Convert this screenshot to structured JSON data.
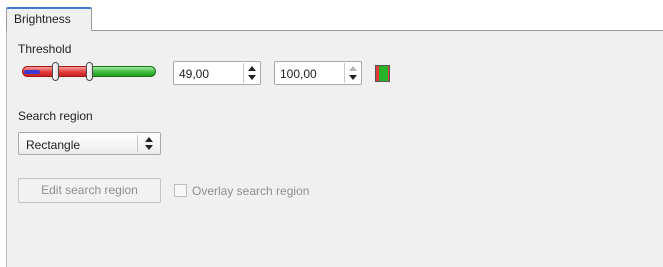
{
  "tabs": [
    {
      "label": "Brightness",
      "active": true
    }
  ],
  "threshold": {
    "label": "Threshold",
    "slider": {
      "low_value": 49,
      "high_value": 100,
      "max": 200,
      "low_color": "#e23c3c",
      "high_color": "#3cbc3c",
      "marker_color": "#3a3ad2"
    },
    "low_spin": {
      "value": "49,00"
    },
    "high_spin": {
      "value": "100,00"
    },
    "color_swatch": {
      "colors": [
        "#e33b3b",
        "#28b428"
      ]
    }
  },
  "search_region": {
    "label": "Search region",
    "selected_option": "Rectangle"
  },
  "edit_button": {
    "label": "Edit search region",
    "enabled": false
  },
  "overlay_checkbox": {
    "label": "Overlay search region",
    "checked": false,
    "enabled": false
  },
  "accent_color": "#3c7fd1"
}
